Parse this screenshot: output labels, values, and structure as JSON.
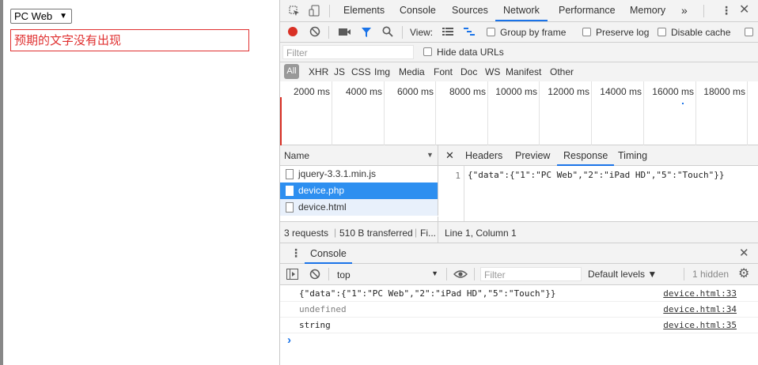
{
  "page": {
    "select_value": "PC Web",
    "message": "预期的文字没有出现"
  },
  "devtools": {
    "main_tabs": [
      "Elements",
      "Console",
      "Sources",
      "Network",
      "Performance",
      "Memory"
    ],
    "active_tab": "Network",
    "more_tabs": "»",
    "network_toolbar": {
      "view_label": "View:",
      "group_by_frame": "Group by frame",
      "preserve_log": "Preserve log",
      "disable_cache": "Disable cache"
    },
    "filter": {
      "placeholder": "Filter",
      "hide_data_urls": "Hide data URLs"
    },
    "type_filters": [
      "All",
      "XHR",
      "JS",
      "CSS",
      "Img",
      "Media",
      "Font",
      "Doc",
      "WS",
      "Manifest",
      "Other"
    ],
    "timeline_ticks": [
      "2000 ms",
      "4000 ms",
      "6000 ms",
      "8000 ms",
      "10000 ms",
      "12000 ms",
      "14000 ms",
      "16000 ms",
      "18000 ms"
    ],
    "requests": {
      "column": "Name",
      "items": [
        "jquery-3.3.1.min.js",
        "device.php",
        "device.html"
      ],
      "selected": "device.php"
    },
    "detail_tabs": [
      "Headers",
      "Preview",
      "Response",
      "Timing"
    ],
    "active_detail_tab": "Response",
    "response": {
      "line_number": "1",
      "text": "{\"data\":{\"1\":\"PC Web\",\"2\":\"iPad HD\",\"5\":\"Touch\"}}"
    },
    "status": {
      "requests": "3 requests",
      "transferred": "510 B transferred",
      "finish": "Fi...",
      "cursor": "Line 1, Column 1"
    },
    "drawer": {
      "tab": "Console",
      "context": "top",
      "filter_placeholder": "Filter",
      "levels": "Default levels ▼",
      "hidden": "1 hidden"
    },
    "console_logs": [
      {
        "message": "{\"data\":{\"1\":\"PC Web\",\"2\":\"iPad HD\",\"5\":\"Touch\"}}",
        "source": "device.html:33",
        "color": "#222222"
      },
      {
        "message": "undefined",
        "source": "device.html:34",
        "color": "#808080"
      },
      {
        "message": "string",
        "source": "device.html:35",
        "color": "#222222"
      }
    ],
    "prompt": "›"
  },
  "colors": {
    "accent": "#1a73e8",
    "record": "#d93025",
    "selected_row": "#2d8ff0",
    "error": "#e03030"
  }
}
